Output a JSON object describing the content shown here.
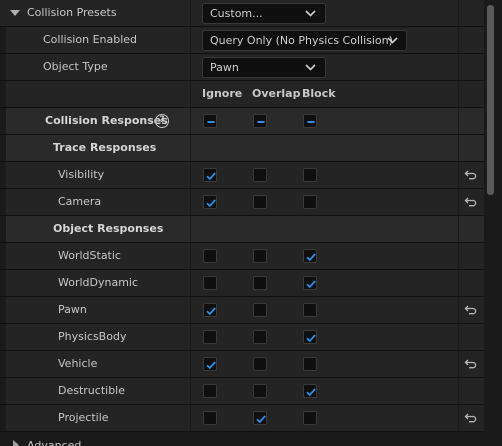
{
  "presets": {
    "label": "Collision Presets",
    "value": "Custom..."
  },
  "collision_enabled": {
    "label": "Collision Enabled",
    "value": "Query Only (No Physics Collision)"
  },
  "object_type": {
    "label": "Object Type",
    "value": "Pawn"
  },
  "columns": {
    "ignore": "Ignore",
    "overlap": "Overlap",
    "block": "Block"
  },
  "collision_responses": {
    "label": "Collision Responses",
    "help": "?"
  },
  "trace_header": "Trace Responses",
  "object_header": "Object Responses",
  "trace": [
    {
      "name": "Visibility",
      "state": "ignore",
      "reset": true
    },
    {
      "name": "Camera",
      "state": "ignore",
      "reset": true
    }
  ],
  "objects": [
    {
      "name": "WorldStatic",
      "state": "block",
      "reset": false
    },
    {
      "name": "WorldDynamic",
      "state": "block",
      "reset": false
    },
    {
      "name": "Pawn",
      "state": "ignore",
      "reset": true
    },
    {
      "name": "PhysicsBody",
      "state": "block",
      "reset": false
    },
    {
      "name": "Vehicle",
      "state": "ignore",
      "reset": true
    },
    {
      "name": "Destructible",
      "state": "block",
      "reset": false
    },
    {
      "name": "Projectile",
      "state": "overlap",
      "reset": true
    }
  ],
  "advanced": "Advanced",
  "colors": {
    "accent": "#2f8fe6",
    "bg": "#242424",
    "header_bg": "#2a2a2a"
  }
}
